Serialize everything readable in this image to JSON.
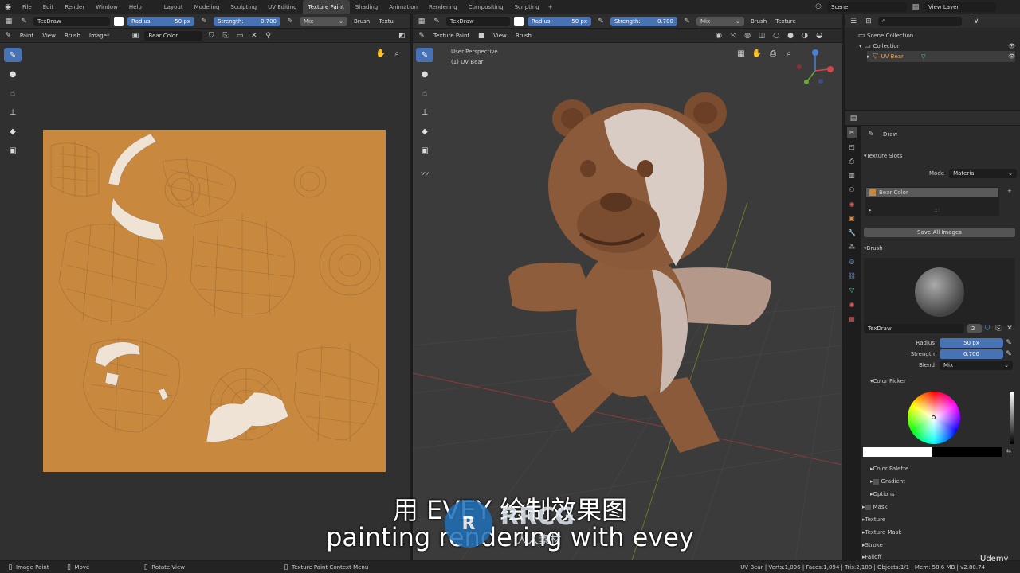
{
  "topbar": {
    "menus": [
      "File",
      "Edit",
      "Render",
      "Window",
      "Help"
    ],
    "workspaces": [
      "Layout",
      "Modeling",
      "Sculpting",
      "UV Editing",
      "Texture Paint",
      "Shading",
      "Animation",
      "Rendering",
      "Compositing",
      "Scripting"
    ],
    "active": "Texture Paint",
    "add": "+",
    "scene": "Scene",
    "view_layer": "View Layer"
  },
  "img_header": {
    "brush": "TexDraw",
    "radius_label": "Radius:",
    "radius_value": "50 px",
    "strength_label": "Strength:",
    "strength_value": "0.700",
    "blend": "Mix",
    "brush_menu": "Brush",
    "texture_menu": "Textu"
  },
  "img_header2": {
    "mode": "Paint",
    "view": "View",
    "brush": "Brush",
    "image": "Image*",
    "image_name": "Bear Color"
  },
  "vp_header": {
    "brush": "TexDraw",
    "radius_label": "Radius:",
    "radius_value": "50 px",
    "strength_label": "Strength:",
    "strength_value": "0.700",
    "blend": "Mix",
    "brush_menu": "Brush",
    "texture_menu": "Texture"
  },
  "vp_header2": {
    "mode": "Texture Paint",
    "view": "View",
    "brush": "Brush"
  },
  "viewport": {
    "perspective": "User Perspective",
    "object": "(1) UV Bear"
  },
  "outliner": {
    "search_placeholder": "",
    "items": [
      "Scene Collection",
      "Collection",
      "UV Bear"
    ]
  },
  "props": {
    "tool_name": "Draw",
    "texture_slots": "Texture Slots",
    "mode_label": "Mode",
    "mode_value": "Material",
    "slot": "Bear Color",
    "dots": ":::",
    "save_all": "Save All Images",
    "brush_section": "Brush",
    "brush_name": "TexDraw",
    "brush_users": "2",
    "radius_label": "Radius",
    "radius_value": "50 px",
    "strength_label": "Strength",
    "strength_value": "0.700",
    "blend_label": "Blend",
    "blend_value": "Mix",
    "color_picker": "Color Picker",
    "color_palette": "Color Palette",
    "gradient": "Gradient",
    "options": "Options",
    "mask": "Mask",
    "texture": "Texture",
    "texture_mask": "Texture Mask",
    "stroke": "Stroke",
    "falloff": "Falloff"
  },
  "statusbar": {
    "left": [
      "Image Paint",
      "Move",
      "Rotate View",
      "Texture Paint Context Menu"
    ],
    "right": "UV Bear | Verts:1,096 | Faces:1,094 | Tris:2,188 | Objects:1/1 | Mem: 58.6 MB | v2.80.74"
  },
  "subtitles": {
    "cn": "用 EVEY 绘制效果图",
    "en": "painting rendering with evey"
  },
  "watermark": {
    "logo": "RRCG",
    "sub": "人人素材",
    "udemy": "Udemy"
  },
  "colors": {
    "accent": "#4772b3",
    "texture_bg": "#c8893e",
    "bear": "#8a5a3a",
    "viewport_bg": "#3b3b3b"
  }
}
